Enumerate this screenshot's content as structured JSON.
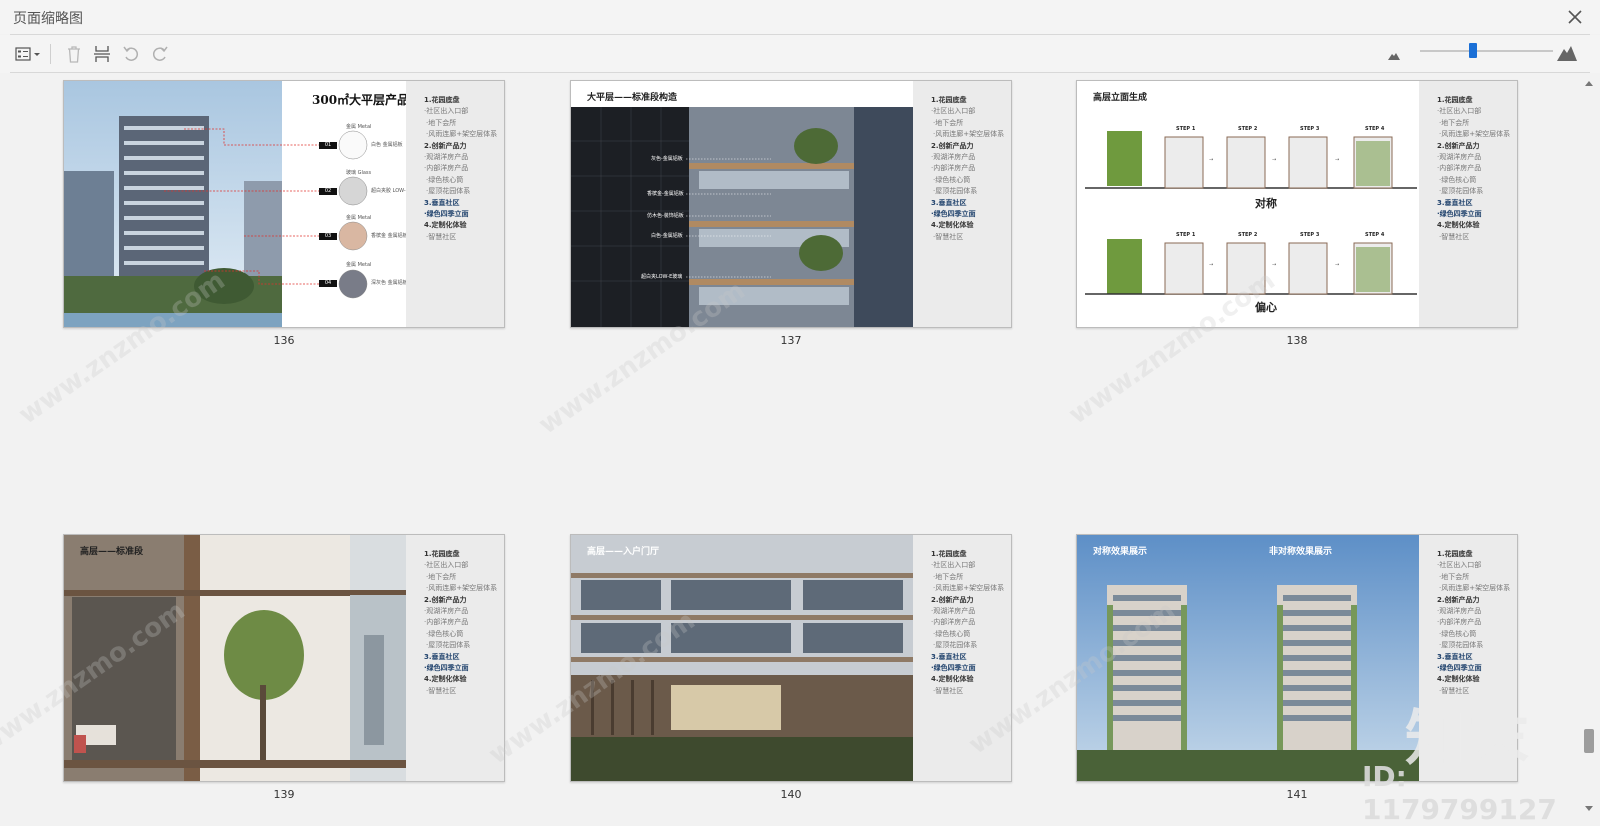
{
  "window": {
    "title": "页面缩略图",
    "close_icon": "close-icon"
  },
  "toolbar": {
    "options_icon": "thumbnail-options-icon",
    "delete_icon": "trash-icon",
    "insert_icon": "insert-pages-icon",
    "undo_icon": "rotate-ccw-icon",
    "redo_icon": "rotate-cw-icon",
    "zoom_small_icon": "mountain-small-icon",
    "zoom_large_icon": "mountain-large-icon",
    "zoom_level_fraction": 0.4
  },
  "sidebar_menu": [
    {
      "text": "1.花园底盘",
      "style": "head"
    },
    {
      "text": "·社区出入口部",
      "style": "item"
    },
    {
      "text": "·地下会所",
      "style": "sub"
    },
    {
      "text": "·风雨连廊+架空层体系",
      "style": "sub"
    },
    {
      "text": "2.创新产品力",
      "style": "head"
    },
    {
      "text": "·观湖洋房产品",
      "style": "item"
    },
    {
      "text": "·内部洋房产品",
      "style": "item"
    },
    {
      "text": "·绿色核心筒",
      "style": "sub"
    },
    {
      "text": "·屋顶花园体系",
      "style": "sub"
    },
    {
      "text": "3.垂直社区",
      "style": "hl"
    },
    {
      "text": "·绿色四季立面",
      "style": "hl"
    },
    {
      "text": "4.定制化体验",
      "style": "head"
    },
    {
      "text": "·智慧社区",
      "style": "sub"
    }
  ],
  "pages": [
    {
      "number": "136",
      "title": "300㎡大平层产品",
      "materials": [
        {
          "num": "01",
          "name": "金属 Metal",
          "desc": "白色 金属铝板"
        },
        {
          "num": "02",
          "name": "玻璃 Glass",
          "desc": "超白夹胶 LOW-E玻璃"
        },
        {
          "num": "03",
          "name": "金属 Metal",
          "desc": "香槟金 金属铝板"
        },
        {
          "num": "04",
          "name": "金属 Metal",
          "desc": "深灰色 金属铝板"
        }
      ]
    },
    {
      "number": "137",
      "title": "大平层——标准段构造",
      "callouts": [
        "灰色-金属铝板",
        "香槟金-金属铝板",
        "仿木色-装饰铝板",
        "白色-金属铝板",
        "超白夹LOW-E玻璃"
      ]
    },
    {
      "number": "138",
      "title": "高层立面生成",
      "steps": [
        "STEP 1",
        "STEP 2",
        "STEP 3",
        "STEP 4"
      ],
      "caption_top": "对称",
      "caption_bottom": "偏心"
    },
    {
      "number": "139",
      "title": "高层——标准段"
    },
    {
      "number": "140",
      "title": "高层——入户门厅"
    },
    {
      "number": "141",
      "title_left": "对称效果展示",
      "title_right": "非对称效果展示"
    }
  ],
  "watermark": {
    "brand": "知末",
    "id": "ID: 1179799127",
    "url": "www.znzmo.com"
  }
}
